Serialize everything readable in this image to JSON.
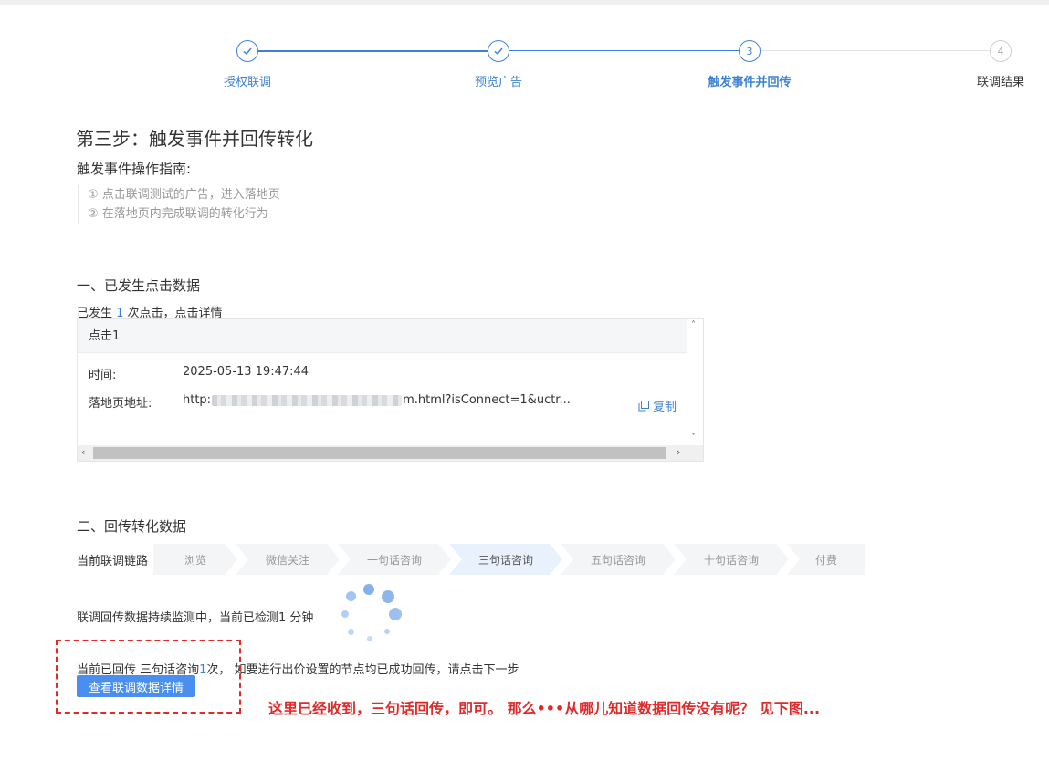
{
  "stepper": {
    "steps": [
      {
        "label": "授权联调",
        "state": "done"
      },
      {
        "label": "预览广告",
        "state": "done"
      },
      {
        "label": "触发事件并回传",
        "number": "3",
        "state": "active"
      },
      {
        "label": "联调结果",
        "number": "4",
        "state": "pending"
      }
    ],
    "colors": {
      "active": "#3b82d6",
      "pending": "#cfcfcf"
    }
  },
  "step_title": "第三步：触发事件并回传转化",
  "guide": {
    "heading": "触发事件操作指南:",
    "items": [
      "① 点击联调测试的广告，进入落地页",
      "② 在落地页内完成联调的转化行为"
    ]
  },
  "click_section": {
    "title": "一、已发生点击数据",
    "summary_prefix": "已发生 ",
    "count": "1",
    "summary_suffix": " 次点击，点击详情",
    "panel": {
      "header": "点击1",
      "time_label": "时间:",
      "time_value": "2025-05-13 19:47:44",
      "url_label": "落地页地址:",
      "url_prefix": "http:",
      "url_suffix": "m.html?isConnect=1&uctr...",
      "copy_label": "复制"
    }
  },
  "conversion_section": {
    "title": "二、回传转化数据",
    "chain_label": "当前联调链路",
    "chain": [
      "浏览",
      "微信关注",
      "一句话咨询",
      "三句话咨询",
      "五句话咨询",
      "十句话咨询",
      "付费"
    ],
    "chain_active": "三句话咨询",
    "monitor_text": "联调回传数据持续监测中，当前已检测1 分钟",
    "result_prefix": "当前已回传 三句话咨询",
    "result_count": "1",
    "result_suffix": "次，  如要进行出价设置的节点均已成功回传，请点击下一步",
    "detail_button": "查看联调数据详情"
  },
  "annotation": "这里已经收到，三句话回传，即可。  那么•••从哪儿知道数据回传没有呢？  见下图..."
}
